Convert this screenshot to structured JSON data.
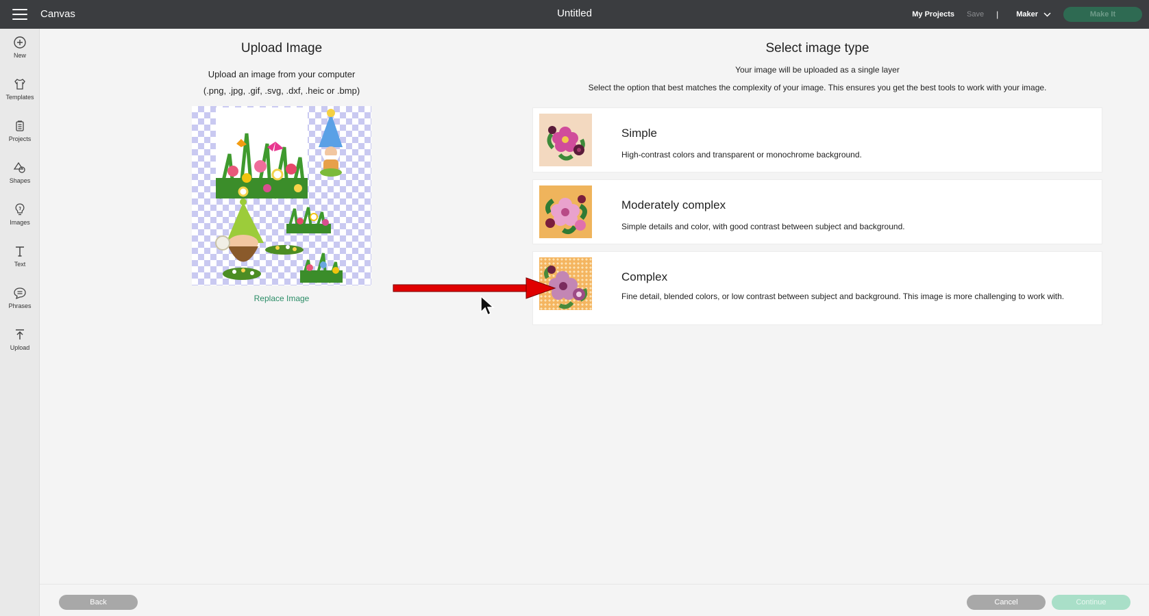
{
  "header": {
    "app_name": "Canvas",
    "doc_title": "Untitled",
    "my_projects": "My Projects",
    "save": "Save",
    "separator": "|",
    "machine": "Maker",
    "make_it": "Make It"
  },
  "sidebar": {
    "items": [
      {
        "label": "New",
        "icon": "plus-circle-icon"
      },
      {
        "label": "Templates",
        "icon": "shirt-icon"
      },
      {
        "label": "Projects",
        "icon": "projects-icon"
      },
      {
        "label": "Shapes",
        "icon": "shapes-icon"
      },
      {
        "label": "Images",
        "icon": "lightbulb-icon"
      },
      {
        "label": "Text",
        "icon": "text-icon"
      },
      {
        "label": "Phrases",
        "icon": "speech-bubble-icon"
      },
      {
        "label": "Upload",
        "icon": "upload-icon"
      }
    ]
  },
  "upload": {
    "title": "Upload Image",
    "line1": "Upload an image from your computer",
    "line2": "(.png, .jpg, .gif, .svg, .dxf, .heic or .bmp)",
    "replace_link": "Replace Image"
  },
  "select": {
    "title": "Select image type",
    "subtitle": "Your image will be uploaded as a single layer",
    "description": "Select the option that best matches the complexity of your image. This ensures you get the best tools to work with your image.",
    "options": [
      {
        "name": "Simple",
        "desc": "High-contrast colors and transparent or monochrome background."
      },
      {
        "name": "Moderately complex",
        "desc": "Simple details and color, with good contrast between subject and background."
      },
      {
        "name": "Complex",
        "desc": "Fine detail, blended colors, or low contrast between subject and background. This image is more challenging to work with."
      }
    ]
  },
  "footer": {
    "back": "Back",
    "cancel": "Cancel",
    "continue": "Continue"
  },
  "colors": {
    "topbar": "#3b3d40",
    "accent_green": "#2a8c66",
    "arrow_red": "#e00000"
  }
}
